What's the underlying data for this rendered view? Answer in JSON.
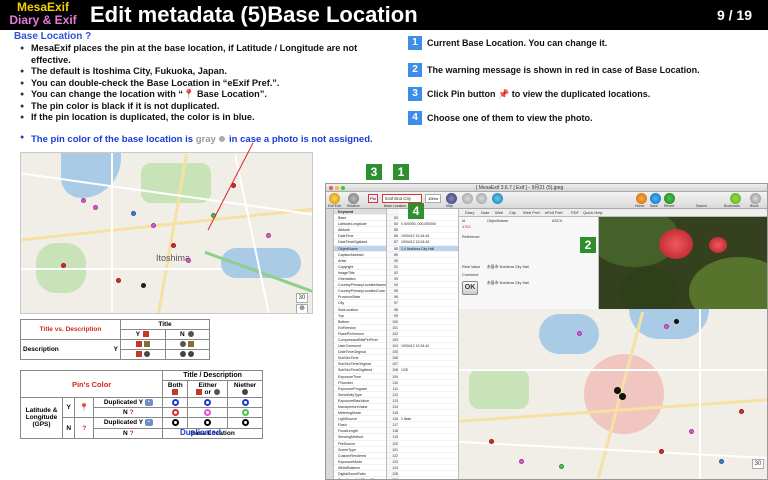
{
  "header": {
    "brand_line1": "MesaExif",
    "brand_line2": "Diary & Exif",
    "title": "Edit metadata (5)Base Location",
    "page": "9 / 19"
  },
  "intro": {
    "heading": "Base Location ?",
    "bullets": [
      "MesaExif places the pin at the base location, if Latitude / Longitude are not effective.",
      "The default is Itoshima City, Fukuoka, Japan.",
      "You can double-check the Base Location in “eExif Pref.”.",
      "You can change the location with “📍 Base Location”.",
      "The pin color is black if it is not duplicated.",
      "If the pin location is duplicated, the color is in blue."
    ],
    "note_start": "The pin color of the base location is ",
    "note_gray": "gray",
    "note_end": " in case a photo is not assigned."
  },
  "steps": [
    {
      "num": "1",
      "text": "Current Base Location. You can change it."
    },
    {
      "num": "2",
      "text": "The warning message is shown in red in case of Base Location."
    },
    {
      "num": "3",
      "text": "Click Pin button 📌 to view the duplicated locations."
    },
    {
      "num": "4",
      "text": "Choose one of them to view the photo."
    }
  ],
  "map": {
    "label_city": "Itoshima",
    "zoom": "30",
    "accent": "#ffffff"
  },
  "table1": {
    "col1": "Title vs. Description",
    "col2": "Title",
    "y": "Y",
    "n": "N",
    "row": "Description"
  },
  "table2": {
    "header": "Pin's Color",
    "title_desc": "Title / Description",
    "both": "Both",
    "either": "Either",
    "neither": "Niether",
    "or": "or",
    "latlon": "Latitude & Longitude (GPS)",
    "y": "Y",
    "n": "N",
    "duplicated": "Duplicated",
    "duplicated_blue": "Duplicated",
    "base_location": "Base Location",
    "q": "?"
  },
  "badges": {
    "b1": "1",
    "b2": "2",
    "b3": "3",
    "b4": "4"
  },
  "app": {
    "window_title": "[ MesaExif 3.6.7 ] Exif ] - 9月21 (5).jpeg",
    "location_value": "Itoshima City",
    "zoom_value": "100m",
    "pin_label": "Pin",
    "toolbar_labels": [
      "Exif Edit",
      "Relative",
      "Base Location",
      "Map",
      "Undo",
      "Redo",
      "Edit all",
      "Diary",
      "Web",
      "Clip",
      "Web Pref.",
      "eExif Pref.",
      "PDF",
      "Quick Help",
      "Home",
      "Save",
      "Revert",
      "Search",
      "Bookmark",
      "Block"
    ],
    "tabs": [
      "Diary",
      "Note",
      "Web",
      "Clip",
      "Web Pref.",
      "eExif Pref.",
      "PDF",
      "Quick Help"
    ],
    "keyword_header": "Keyword",
    "keywords": [
      "Base",
      "LatitudeLongitude",
      "Altitude",
      "DateTime",
      "DateTimeDigitized",
      "ObjectName",
      "CaptionAbstract",
      "Artist",
      "Copyright",
      "ImageTitle",
      "Orientation",
      "CountryPrimaryLocationName",
      "CountryPrimaryLocationCode",
      "ProvinceState",
      "City",
      "SubLocation",
      "Top",
      "Bottom",
      "ExifVersion",
      "FlashPixVersion",
      "CompressedBitsPerPixel",
      "UserComment",
      "DateTimeOriginal",
      "SubSecTime",
      "SubSecTimeOriginal",
      "SubSecTimeDigitized",
      "ExposureTime",
      "FNumber",
      "ExposureProgram",
      "SensitivityType",
      "ExposureBiasValue",
      "MaxApertureValue",
      "MeteringMode",
      "LightSource",
      "Flash",
      "FocalLength",
      "SensingMethod",
      "FileSource",
      "SceneType",
      "CustomRendered",
      "ExposureMode",
      "WhiteBalance",
      "DigitalZoomRatio",
      "FocalLengthIn35mmFilm",
      "SceneCaptureType"
    ],
    "ids": [
      "",
      "83",
      "84",
      "85",
      "86",
      "87",
      "88",
      "89",
      "90",
      "91",
      "92",
      "93",
      "94",
      "95",
      "96",
      "97",
      "98",
      "99",
      "100",
      "101",
      "102",
      "103",
      "104",
      "105",
      "106",
      "107",
      "108",
      "109",
      "110",
      "111",
      "112",
      "113",
      "114",
      "115",
      "116",
      "117",
      "118",
      "119",
      "120",
      "121",
      "122",
      "123",
      "124",
      "125",
      "126"
    ],
    "values": [
      "",
      "",
      "0.000000, 000.000000",
      "",
      "19/04/12 13:24:43",
      "19/04/12 13:24:43",
      "1.4 Itoshima City Hall",
      "",
      "",
      "",
      "",
      "",
      "",
      "",
      "",
      "",
      "",
      "",
      "",
      "",
      "",
      "",
      "19/04/12 13:24:42",
      "",
      "",
      "",
      "1/25",
      "",
      "",
      "",
      "",
      "",
      "",
      "",
      "1 flash",
      "",
      "",
      "",
      "",
      "",
      "",
      "",
      "",
      "",
      ""
    ],
    "detail_rows": [
      "Id",
      "4763",
      "Reference",
      "Real Value",
      "Comment"
    ],
    "detail_object": "ObjectName",
    "detail_ascii": "ASCII",
    "detail_real": "糸島市 Itoshima City Hall",
    "detail_comment": "糸島市 Itoshima City Hall",
    "ok_label": "OK",
    "map_zoom": "30"
  }
}
